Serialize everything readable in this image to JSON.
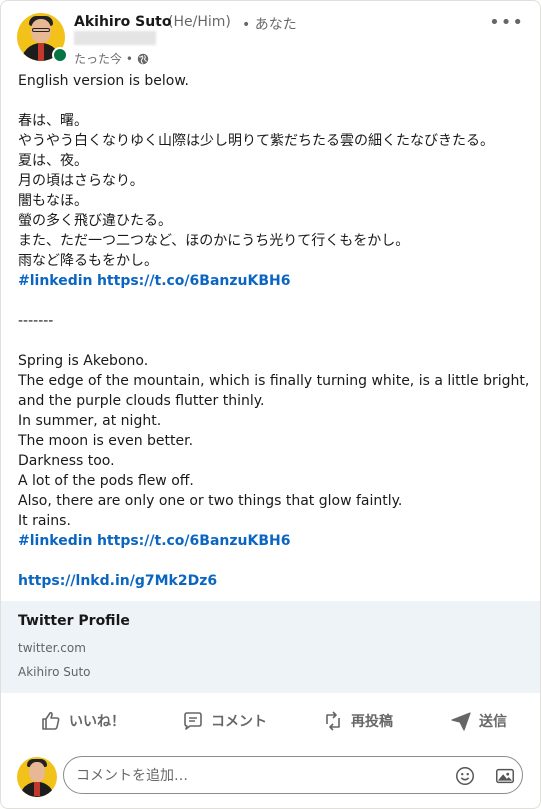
{
  "post": {
    "author_name": "Akihiro Suto",
    "pronouns": "(He/Him)",
    "relation": "• あなた",
    "time": "たった今 •",
    "menu_icon": "more-icon",
    "lines": [
      "English version is below.",
      "",
      "春は、曙。",
      "やうやう白くなりゆく山際は少し明りて紫だちたる雲の細くたなびきたる。",
      "夏は、夜。",
      "月の頃はさらなり。",
      "闇もなほ。",
      "螢の多く飛び違ひたる。",
      "また、ただ一つ二つなど、ほのかにうち光りて行くもをかし。",
      "雨など降るもをかし。"
    ],
    "tag1": "#linkedin",
    "url1": "https://t.co/6BanzuKBH6",
    "separator": "-------",
    "en_lines": [
      "Spring is Akebono.",
      "The edge of the mountain, which is finally turning white, is a little bright,",
      "and the purple clouds flutter thinly.",
      "In summer, at night.",
      "The moon is even better.",
      "Darkness too.",
      "A lot of the pods flew off.",
      "Also, there are only one or two things that glow faintly.",
      "It rains."
    ],
    "tag2": "#linkedin",
    "url2": "https://t.co/6BanzuKBH6",
    "short_url": "https://lnkd.in/g7Mk2Dz6"
  },
  "preview": {
    "title": "Twitter Profile",
    "domain": "twitter.com",
    "author": "Akihiro Suto"
  },
  "actions": {
    "like": "いいね！",
    "comment": "コメント",
    "repost": "再投稿",
    "send": "送信"
  },
  "comment_box": {
    "placeholder": "コメントを追加…"
  },
  "colors": {
    "link": "#0a66c2",
    "presence": "#057642",
    "preview_bg": "#eef3f8"
  }
}
